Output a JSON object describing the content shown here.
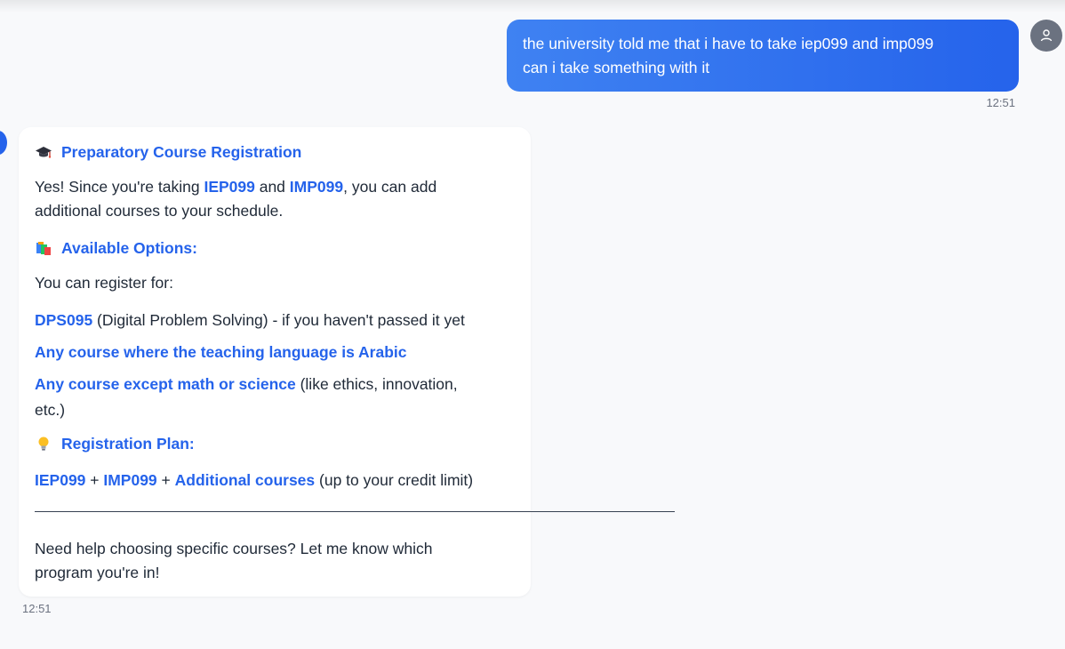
{
  "user_message": {
    "line1": "the university told me that i have to take iep099 and imp099",
    "line2": "can i take something with it",
    "time": "12:51"
  },
  "assistant_message": {
    "title": "Preparatory Course Registration",
    "intro": {
      "a": "Yes! Since you're taking ",
      "code1": "IEP099",
      "b": " and ",
      "code2": "IMP099",
      "c": ", you can add",
      "line2": "additional courses to your schedule."
    },
    "options_heading": "Available Options:",
    "register_text": "You can register for:",
    "option1": {
      "code": "DPS095",
      "rest": " (Digital Problem Solving) - if you haven't passed it yet"
    },
    "option2": "Any course where the teaching language is Arabic",
    "option3": {
      "bold": "Any course except math or science",
      "rest": " (like ethics, innovation,",
      "line2": "etc.)"
    },
    "plan_heading": "Registration Plan:",
    "plan": {
      "a": "IEP099",
      "plus1": " + ",
      "b": "IMP099",
      "plus2": " + ",
      "c": "Additional courses",
      "rest": " (up to your credit limit)"
    },
    "closing_line1": "Need help choosing specific courses? Let me know which",
    "closing_line2": "program you're in!",
    "time": "12:51"
  },
  "icons": {
    "user_avatar": "person-icon",
    "title_emoji": "graduation-cap-icon",
    "options_emoji": "books-icon",
    "plan_emoji": "lightbulb-icon"
  },
  "colors": {
    "accent": "#2563eb",
    "user_bubble": "#3b7ff0",
    "background": "#f8f9fb"
  }
}
